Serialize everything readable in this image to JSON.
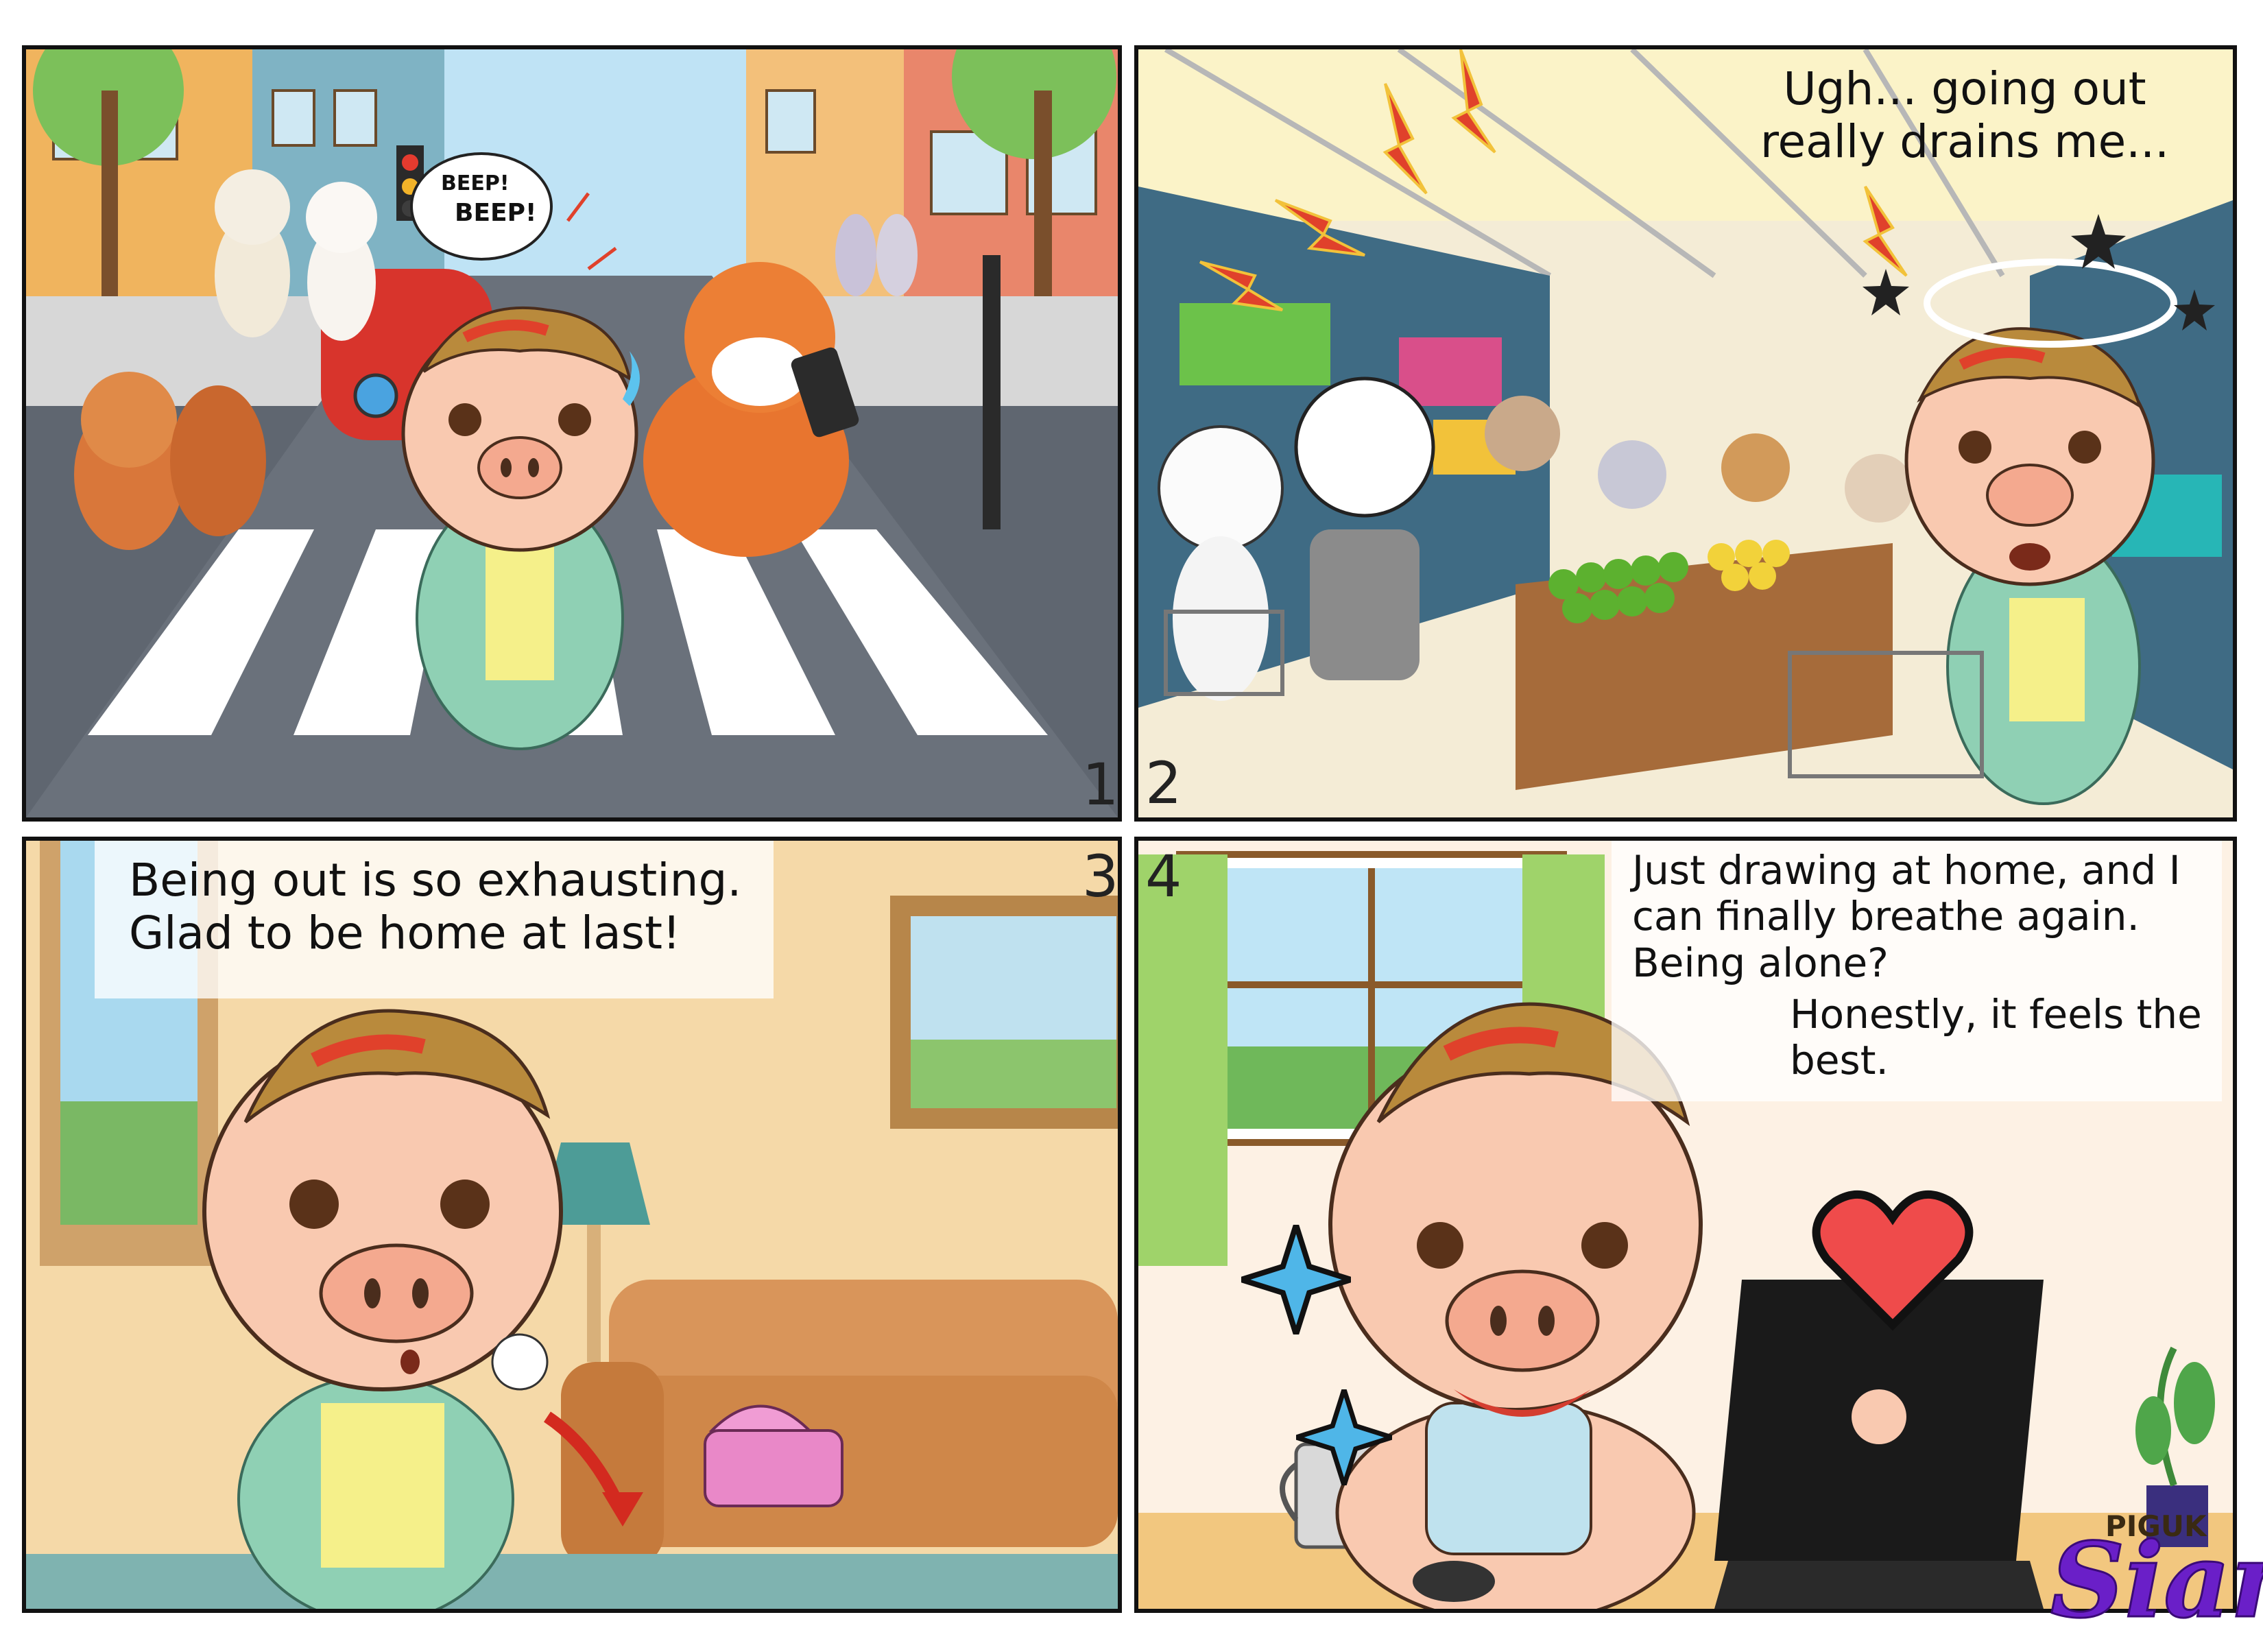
{
  "panels": [
    {
      "number": "1",
      "bubble_beep_1": "BEEP!",
      "bubble_beep_2": "BEEP!"
    },
    {
      "number": "2",
      "caption": "Ugh... going out\nreally drains me..."
    },
    {
      "number": "3",
      "caption": "Being out is so exhausting.\nGlad to be home at last!"
    },
    {
      "number": "4",
      "caption_line1": "Just drawing at home, and I\ncan finally breathe again.\nBeing alone?",
      "caption_line2": "Honestly, it feels the\nbest."
    }
  ],
  "watermark": {
    "brand": "PIGUK",
    "signature": "Sian"
  },
  "colors": {
    "pig_skin": "#f9c9b0",
    "pig_hair": "#b98a3c",
    "pig_hair_streak": "#e0412b",
    "cardigan": "#8fd0b4",
    "dress": "#f5f08a",
    "road": "#5f6670",
    "sofa": "#d9955a",
    "heart": "#ef4b4b",
    "sparkle": "#4fb6e8",
    "laptop": "#1a1a1a"
  }
}
